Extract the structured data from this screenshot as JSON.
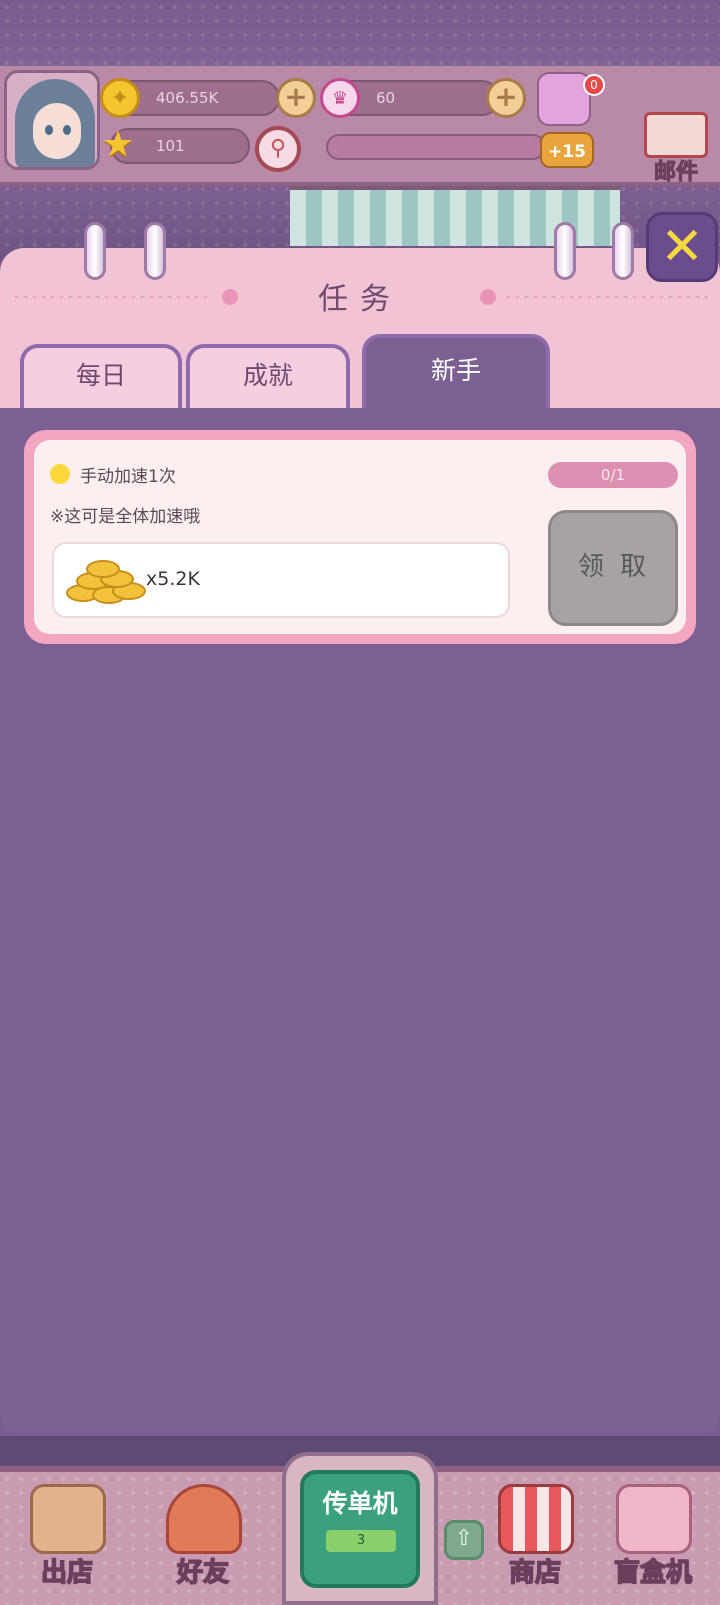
{
  "hud": {
    "coins": "406.55K",
    "stars": "101",
    "crowns": "60",
    "level_bonus": "+15",
    "notification_count": "0",
    "mail_label": "邮件"
  },
  "panel": {
    "title": "任务",
    "close_label": "✕",
    "tabs": [
      {
        "label": "每日",
        "active": false
      },
      {
        "label": "成就",
        "active": false
      },
      {
        "label": "新手",
        "active": true
      }
    ]
  },
  "task": {
    "name": "手动加速1次",
    "note": "※这可是全体加速哦",
    "progress": "0/1",
    "reward_icon": "coin-stack-icon",
    "reward_amount": "x5.2K",
    "claim_label": "领取"
  },
  "bottom_nav": {
    "leave_shop": "出店",
    "friends": "好友",
    "flyer_machine": "传单机",
    "flyer_count": "3",
    "shop": "商店",
    "blind_box": "盲盒机"
  },
  "colors": {
    "panel_bg": "#7d6093",
    "panel_head": "#f2c3d5",
    "card_border": "#f2a6c2",
    "close_accent": "#f6d840",
    "claim_disabled": "#a7a3a3"
  }
}
